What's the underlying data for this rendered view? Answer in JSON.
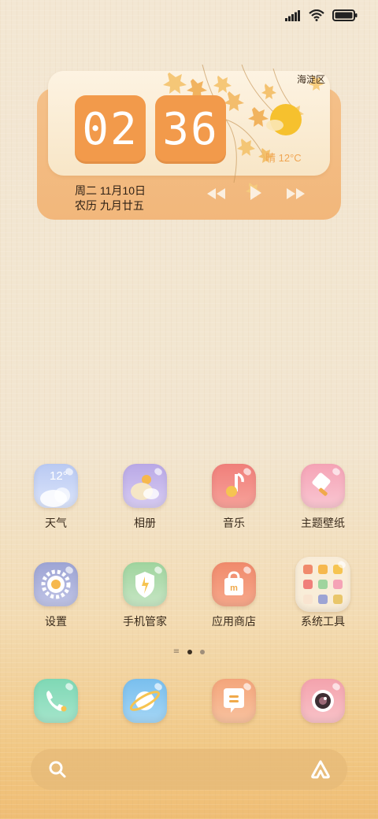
{
  "status_bar": {
    "signal": "signal-icon",
    "wifi": "wifi-icon",
    "battery": "battery-icon"
  },
  "clock_widget": {
    "district": "海淀区",
    "hour": "02",
    "minute": "36",
    "weather": "晴 12°C",
    "date_line1": "周二 11月10日",
    "date_line2": "农历 九月廿五",
    "controls": [
      "previous-icon",
      "play-icon",
      "next-icon"
    ]
  },
  "apps_row1": [
    {
      "label": "天气",
      "icon": "weather-icon",
      "badge": "12°"
    },
    {
      "label": "相册",
      "icon": "gallery-icon"
    },
    {
      "label": "音乐",
      "icon": "music-icon"
    },
    {
      "label": "主题壁纸",
      "icon": "theme-icon"
    }
  ],
  "apps_row2": [
    {
      "label": "设置",
      "icon": "settings-icon"
    },
    {
      "label": "手机管家",
      "icon": "security-icon"
    },
    {
      "label": "应用商店",
      "icon": "store-icon"
    },
    {
      "label": "系统工具",
      "icon": "folder-icon"
    }
  ],
  "page_indicator": {
    "pages": 2,
    "current": 1
  },
  "dock": [
    {
      "icon": "phone-icon"
    },
    {
      "icon": "browser-icon"
    },
    {
      "icon": "messages-icon"
    },
    {
      "icon": "camera-icon"
    }
  ],
  "search_bar": {
    "left_icon": "search-icon",
    "right_icon": "assistant-icon"
  },
  "colors": {
    "accent": "#f29a4b",
    "text": "#3a2b1c",
    "widget_base": "#f2b77b"
  }
}
